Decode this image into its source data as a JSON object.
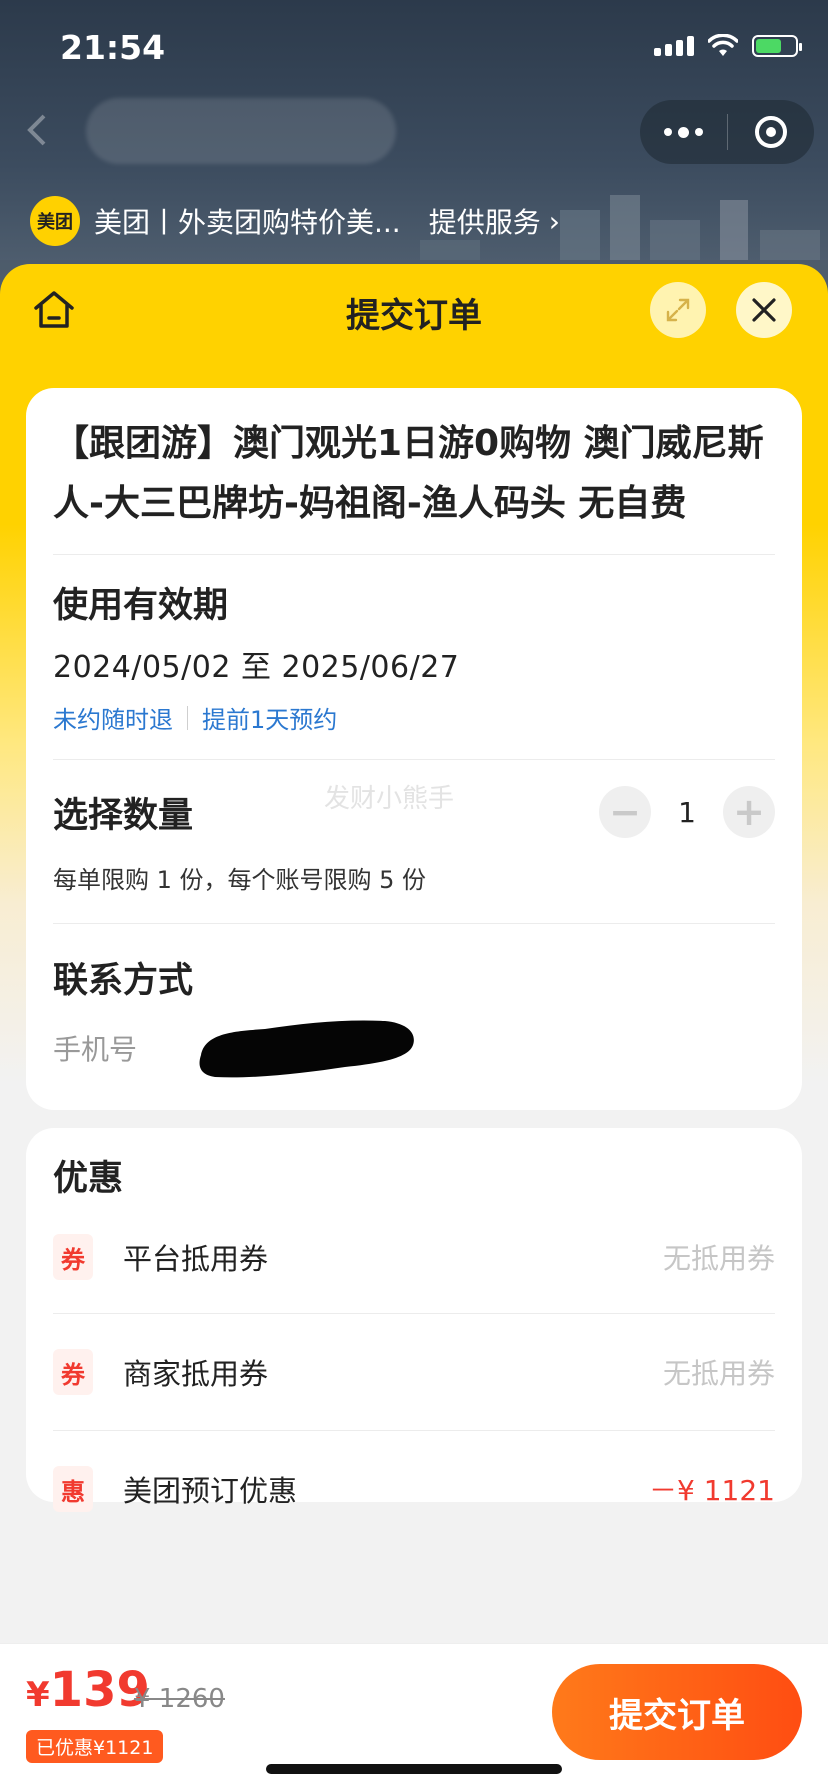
{
  "status_bar": {
    "time": "21:54"
  },
  "host": {
    "provider_logo_text": "美团",
    "provider_name": "美团丨外卖团购特价美...",
    "provider_service": "提供服务"
  },
  "sheet": {
    "title": "提交订单"
  },
  "product": {
    "title": "【跟团游】澳门观光1日游0购物 澳门威尼斯人-大三巴牌坊-妈祖阁-渔人码头 无自费"
  },
  "validity": {
    "label": "使用有效期",
    "dates": "2024/05/02 至 2025/06/27",
    "refund_policy": "未约随时退",
    "booking_policy": "提前1天预约"
  },
  "quantity": {
    "label": "选择数量",
    "value": "1",
    "minus_symbol": "−",
    "plus_symbol": "+",
    "limit_text": "每单限购 1 份，每个账号限购 5 份",
    "watermark": "发财小熊手"
  },
  "contact": {
    "label": "联系方式",
    "phone_label": "手机号"
  },
  "discounts": {
    "title": "优惠",
    "items": [
      {
        "tag": "券",
        "name": "平台抵用券",
        "value": "无抵用券"
      },
      {
        "tag": "券",
        "name": "商家抵用券",
        "value": "无抵用券"
      },
      {
        "tag": "惠",
        "name": "美团预订优惠",
        "value": "－¥ 1121"
      }
    ]
  },
  "footer": {
    "currency": "¥",
    "price": "139",
    "original_price": "¥ 1260",
    "saved_text": "已优惠¥1121",
    "submit_label": "提交订单"
  },
  "colors": {
    "brand_yellow": "#ffd200",
    "accent_red": "#f13a2f",
    "submit_orange": "#ff5a1f",
    "link_blue": "#2b78d0"
  },
  "icons": [
    "signal-icon",
    "wifi-icon",
    "battery-icon",
    "back-icon",
    "more-icon",
    "target-icon",
    "chevron-right-icon",
    "home-icon",
    "expand-icon",
    "close-icon"
  ]
}
